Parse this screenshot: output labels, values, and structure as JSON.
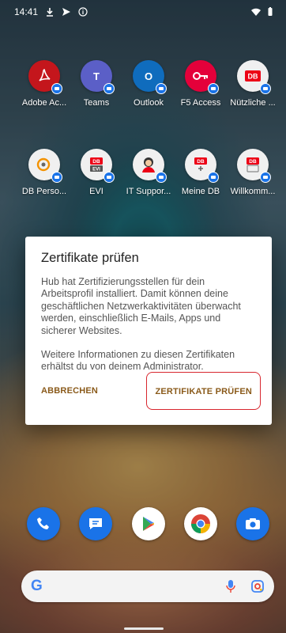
{
  "status_bar": {
    "time": "14:41",
    "left_icons": [
      "download-icon",
      "send-icon",
      "info-icon"
    ],
    "right_icons": [
      "wifi-icon",
      "battery-icon"
    ]
  },
  "apps": {
    "row1": [
      {
        "label": "Adobe Ac...",
        "icon": "adobe-acrobat-icon",
        "color": "#c4161c"
      },
      {
        "label": "Teams",
        "icon": "teams-icon",
        "color": "#5b5fc7"
      },
      {
        "label": "Outlook",
        "icon": "outlook-icon",
        "color": "#0f6cbd"
      },
      {
        "label": "F5 Access",
        "icon": "f5-access-icon",
        "color": "#e4003a"
      },
      {
        "label": "Nützliche ...",
        "icon": "db-nuetzliche-icon",
        "color": "#f0f0f0"
      }
    ],
    "row2": [
      {
        "label": "DB Perso...",
        "icon": "db-personal-icon",
        "color": "#f0f0f0"
      },
      {
        "label": "EVI",
        "icon": "evi-icon",
        "color": "#f0f0f0"
      },
      {
        "label": "IT Suppor...",
        "icon": "it-support-icon",
        "color": "#f0f0f0"
      },
      {
        "label": "Meine DB",
        "icon": "meine-db-icon",
        "color": "#f0f0f0"
      },
      {
        "label": "Willkomm...",
        "icon": "willkommen-icon",
        "color": "#f0f0f0"
      }
    ]
  },
  "dialog": {
    "title": "Zertifikate prüfen",
    "body1": "Hub hat Zertifizierungsstellen für dein Arbeitsprofil installiert. Damit können deine geschäftlichen Netzwerkaktivitäten überwacht werden, einschließlich E-Mails, Apps und sicherer Websites.",
    "body2": "Weitere Informationen zu diesen Zertifikaten erhältst du von deinem Administrator.",
    "cancel_label": "ABBRECHEN",
    "confirm_label": "ZERTIFIKATE PRÜFEN"
  },
  "dock": [
    {
      "icon": "phone-icon",
      "color": "#1a73e8"
    },
    {
      "icon": "messages-icon",
      "color": "#1a73e8"
    },
    {
      "icon": "play-store-icon",
      "color": "#ffffff"
    },
    {
      "icon": "chrome-icon",
      "color": "#ffffff"
    },
    {
      "icon": "camera-icon",
      "color": "#1a73e8"
    }
  ],
  "search": {
    "logo": "G",
    "icons": [
      "mic-icon",
      "lens-icon"
    ]
  }
}
